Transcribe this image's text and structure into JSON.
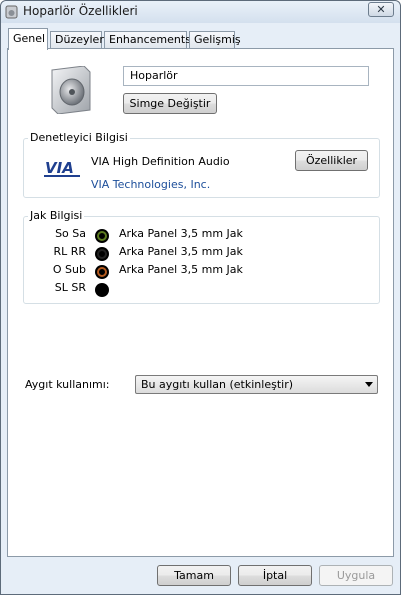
{
  "window": {
    "title": "Hoparlör Özellikleri",
    "close_label": "✕"
  },
  "tabs": [
    {
      "label": "Genel",
      "active": true
    },
    {
      "label": "Düzeyler",
      "active": false
    },
    {
      "label": "Enhancements",
      "active": false
    },
    {
      "label": "Gelişmiş",
      "active": false
    }
  ],
  "device": {
    "name": "Hoparlör",
    "change_icon_label": "Simge Değiştir"
  },
  "controller": {
    "group_title": "Denetleyici Bilgisi",
    "name": "VIA High Definition Audio",
    "vendor": "VIA Technologies, Inc.",
    "properties_label": "Özellikler"
  },
  "jacks": {
    "group_title": "Jak Bilgisi",
    "rows": [
      {
        "label": "So Sa",
        "color": "#5b7a1f",
        "text": "Arka Panel 3,5 mm Jak"
      },
      {
        "label": "RL RR",
        "color": "#000000",
        "text": "Arka Panel 3,5 mm Jak"
      },
      {
        "label": "O Sub",
        "color": "#b35a1f",
        "text": "Arka Panel 3,5 mm Jak"
      },
      {
        "label": "SL SR",
        "color": "#000000",
        "text": ""
      }
    ]
  },
  "usage": {
    "label": "Aygıt kullanımı:",
    "value": "Bu aygıtı kullan (etkinleştir)"
  },
  "footer": {
    "ok_label": "Tamam",
    "cancel_label": "İptal",
    "apply_label": "Uygula"
  }
}
